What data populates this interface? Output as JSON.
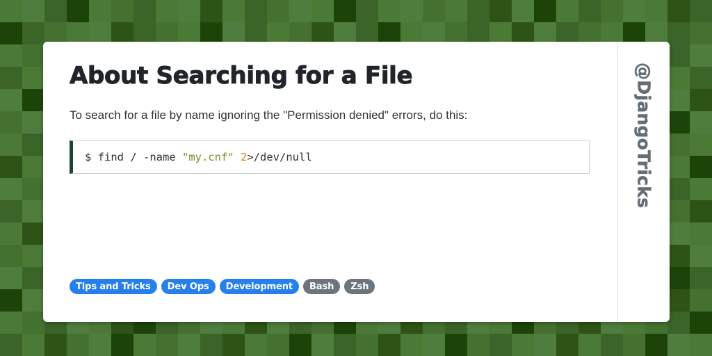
{
  "page": {
    "title": "About Searching for a File",
    "intro": "To search for a file by name ignoring the \"Permission denied\" errors, do this:"
  },
  "code_block": {
    "language": "bash",
    "full_text": "$ find / -name \"my.cnf\" 2>/dev/null",
    "tokens": [
      {
        "text": "$ find / -name ",
        "type": "plain"
      },
      {
        "text": "\"my.cnf\"",
        "type": "string"
      },
      {
        "text": " ",
        "type": "plain"
      },
      {
        "text": "2",
        "type": "number"
      },
      {
        "text": ">/dev/null",
        "type": "plain"
      }
    ],
    "accent_color": "#1b4433",
    "string_color": "#74902b",
    "number_color": "#e28217",
    "text_color": "#333333"
  },
  "tags": [
    {
      "label": "Tips and Tricks",
      "style": "primary",
      "color": "#2680eb"
    },
    {
      "label": "Dev Ops",
      "style": "primary",
      "color": "#2680eb"
    },
    {
      "label": "Development",
      "style": "primary",
      "color": "#2680eb"
    },
    {
      "label": "Bash",
      "style": "secondary",
      "color": "#6c757d"
    },
    {
      "label": "Zsh",
      "style": "secondary",
      "color": "#6c757d"
    }
  ],
  "sidebar": {
    "handle": "@DjangoTricks",
    "color": "#656e77"
  },
  "background": {
    "tile_size": 32,
    "palette": [
      "#4a7a35",
      "#4f7d3e",
      "#3a6428",
      "#1d4408",
      "#2d5416",
      "#447130"
    ],
    "tiles": [
      [
        0,
        1,
        2,
        3,
        0,
        5,
        2,
        0,
        1,
        4,
        0,
        2,
        5,
        1,
        0,
        3,
        2,
        0,
        1,
        5,
        0,
        2,
        4,
        1,
        3,
        0,
        2,
        5,
        1,
        0,
        4,
        2
      ],
      [
        3,
        2,
        5,
        0,
        1,
        4,
        2,
        5,
        0,
        3,
        1,
        2,
        0,
        5,
        4,
        1,
        2,
        3,
        0,
        1,
        5,
        2,
        0,
        4,
        1,
        2,
        5,
        0,
        3,
        1,
        2,
        5
      ],
      [
        0,
        5,
        1,
        2,
        4,
        0,
        3,
        1,
        2,
        0,
        5,
        4,
        1,
        0,
        2,
        5,
        3,
        1,
        0,
        2,
        4,
        5,
        1,
        0,
        2,
        3,
        1,
        4,
        0,
        5,
        2,
        1
      ],
      [
        2,
        0,
        4,
        1,
        5,
        2,
        0,
        3,
        5,
        1,
        2,
        4,
        0,
        1,
        5,
        2,
        0,
        3,
        1,
        4,
        2,
        0,
        5,
        1,
        3,
        2,
        0,
        4,
        5,
        1,
        0,
        2
      ],
      [
        1,
        3,
        0,
        5,
        2,
        1,
        4,
        0,
        2,
        5,
        3,
        1,
        0,
        2,
        4,
        0,
        5,
        1,
        2,
        3,
        0,
        5,
        2,
        4,
        1,
        0,
        3,
        2,
        5,
        0,
        1,
        4
      ],
      [
        5,
        1,
        2,
        0,
        3,
        5,
        1,
        2,
        4,
        0,
        1,
        5,
        2,
        3,
        0,
        1,
        4,
        2,
        5,
        0,
        1,
        2,
        3,
        5,
        0,
        4,
        1,
        2,
        0,
        5,
        3,
        1
      ],
      [
        0,
        2,
        5,
        4,
        1,
        0,
        2,
        5,
        1,
        3,
        0,
        2,
        4,
        1,
        5,
        0,
        2,
        1,
        3,
        5,
        4,
        0,
        1,
        2,
        5,
        1,
        0,
        3,
        2,
        4,
        5,
        0
      ],
      [
        4,
        0,
        1,
        2,
        5,
        3,
        0,
        1,
        2,
        5,
        4,
        0,
        3,
        5,
        1,
        2,
        0,
        5,
        1,
        0,
        2,
        3,
        5,
        1,
        0,
        2,
        4,
        1,
        5,
        2,
        0,
        3
      ],
      [
        1,
        5,
        2,
        0,
        4,
        1,
        5,
        3,
        0,
        2,
        1,
        5,
        0,
        4,
        2,
        3,
        1,
        0,
        5,
        2,
        1,
        4,
        0,
        5,
        2,
        0,
        1,
        5,
        3,
        1,
        2,
        0
      ],
      [
        2,
        1,
        0,
        5,
        3,
        2,
        1,
        0,
        5,
        4,
        2,
        3,
        1,
        0,
        5,
        1,
        4,
        2,
        0,
        3,
        5,
        1,
        2,
        0,
        4,
        5,
        3,
        0,
        1,
        2,
        5,
        4
      ],
      [
        0,
        4,
        3,
        1,
        2,
        0,
        5,
        4,
        1,
        2,
        0,
        1,
        5,
        2,
        3,
        4,
        0,
        5,
        1,
        2,
        0,
        3,
        4,
        5,
        1,
        2,
        0,
        5,
        4,
        3,
        1,
        0
      ],
      [
        5,
        0,
        1,
        2,
        4,
        5,
        0,
        2,
        3,
        1,
        5,
        0,
        2,
        4,
        1,
        0,
        5,
        3,
        2,
        1,
        0,
        4,
        5,
        2,
        3,
        0,
        1,
        5,
        2,
        0,
        4,
        1
      ],
      [
        1,
        2,
        5,
        0,
        3,
        1,
        4,
        5,
        2,
        0,
        1,
        3,
        4,
        5,
        0,
        2,
        1,
        5,
        0,
        4,
        3,
        2,
        1,
        5,
        0,
        1,
        2,
        4,
        0,
        5,
        3,
        2
      ],
      [
        3,
        1,
        0,
        4,
        5,
        2,
        1,
        0,
        4,
        5,
        3,
        2,
        0,
        1,
        5,
        4,
        2,
        0,
        3,
        1,
        5,
        0,
        2,
        4,
        1,
        3,
        5,
        0,
        2,
        1,
        4,
        5
      ],
      [
        0,
        5,
        2,
        1,
        0,
        4,
        3,
        2,
        5,
        1,
        0,
        4,
        1,
        2,
        5,
        3,
        0,
        1,
        4,
        5,
        2,
        1,
        0,
        3,
        5,
        2,
        4,
        1,
        0,
        5,
        2,
        3
      ],
      [
        2,
        0,
        4,
        5,
        1,
        3,
        0,
        5,
        1,
        2,
        4,
        0,
        5,
        3,
        1,
        2,
        5,
        4,
        0,
        1,
        3,
        5,
        2,
        0,
        1,
        4,
        0,
        2,
        5,
        3,
        1,
        0
      ]
    ]
  }
}
